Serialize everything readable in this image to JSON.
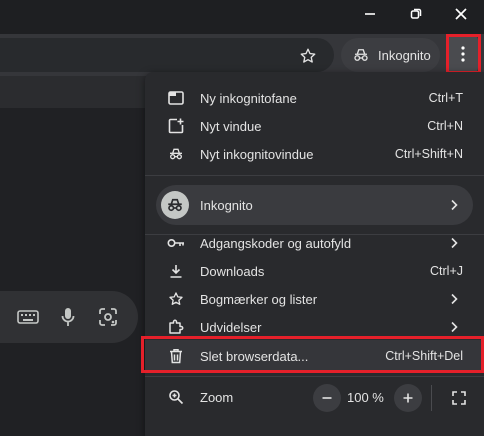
{
  "toolbar": {
    "incognito_label": "Inkognito"
  },
  "menu": {
    "items": [
      {
        "label": "Ny inkognitofane",
        "shortcut": "Ctrl+T",
        "icon": "new-tab-icon"
      },
      {
        "label": "Nyt vindue",
        "shortcut": "Ctrl+N",
        "icon": "new-window-icon"
      },
      {
        "label": "Nyt inkognitovindue",
        "shortcut": "Ctrl+Shift+N",
        "icon": "incognito-icon"
      }
    ],
    "profile": {
      "label": "Inkognito",
      "icon": "incognito-avatar-icon"
    },
    "items2": [
      {
        "label": "Adgangskoder og autofyld",
        "shortcut": "",
        "icon": "key-icon"
      },
      {
        "label": "Downloads",
        "shortcut": "Ctrl+J",
        "icon": "download-icon"
      },
      {
        "label": "Bogmærker og lister",
        "shortcut": "",
        "icon": "star-icon"
      },
      {
        "label": "Udvidelser",
        "shortcut": "",
        "icon": "extension-icon"
      },
      {
        "label": "Slet browserdata...",
        "shortcut": "Ctrl+Shift+Del",
        "icon": "trash-icon"
      }
    ],
    "zoom": {
      "label": "Zoom",
      "value": "100 %",
      "icon": "zoom-icon"
    }
  },
  "colors": {
    "highlight": "#e5202a",
    "menu_bg": "#292a2d"
  }
}
